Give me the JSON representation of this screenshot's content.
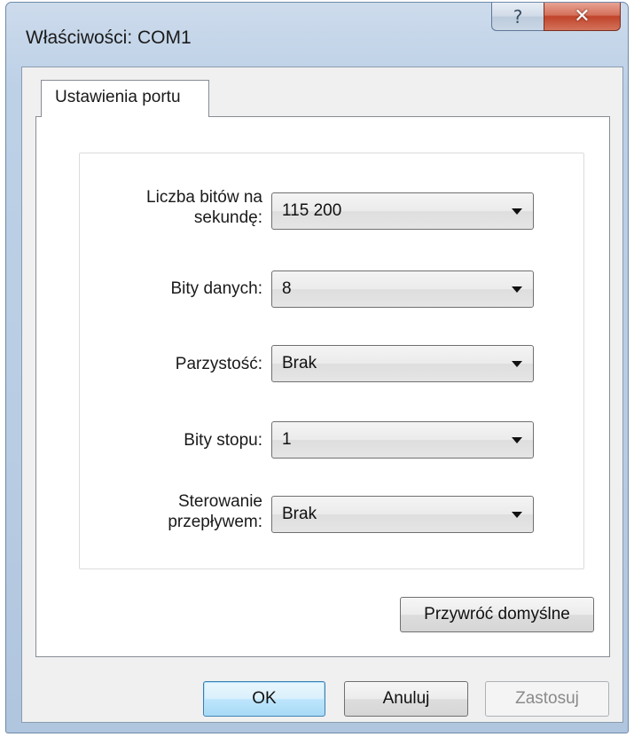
{
  "window": {
    "title": "Właściwości: COM1",
    "help_glyph": "?",
    "close_glyph": "✕"
  },
  "tabs": [
    {
      "label": "Ustawienia portu",
      "selected": true
    }
  ],
  "settings": [
    {
      "label_line1": "Liczba bitów na",
      "label_line2": "sekundę:",
      "value": "115 200"
    },
    {
      "label_line1": "Bity danych:",
      "value": "8"
    },
    {
      "label_line1": "Parzystość:",
      "value": "Brak"
    },
    {
      "label_line1": "Bity stopu:",
      "value": "1"
    },
    {
      "label_line1": "Sterowanie",
      "label_line2": "przepływem:",
      "value": "Brak"
    }
  ],
  "buttons": {
    "restore_defaults": "Przywróć domyślne",
    "ok": "OK",
    "cancel": "Anuluj",
    "apply": "Zastosuj"
  },
  "colors": {
    "frame": "#b8cce3",
    "close_button": "#c0432a",
    "default_button_border": "#3c7fb1"
  }
}
